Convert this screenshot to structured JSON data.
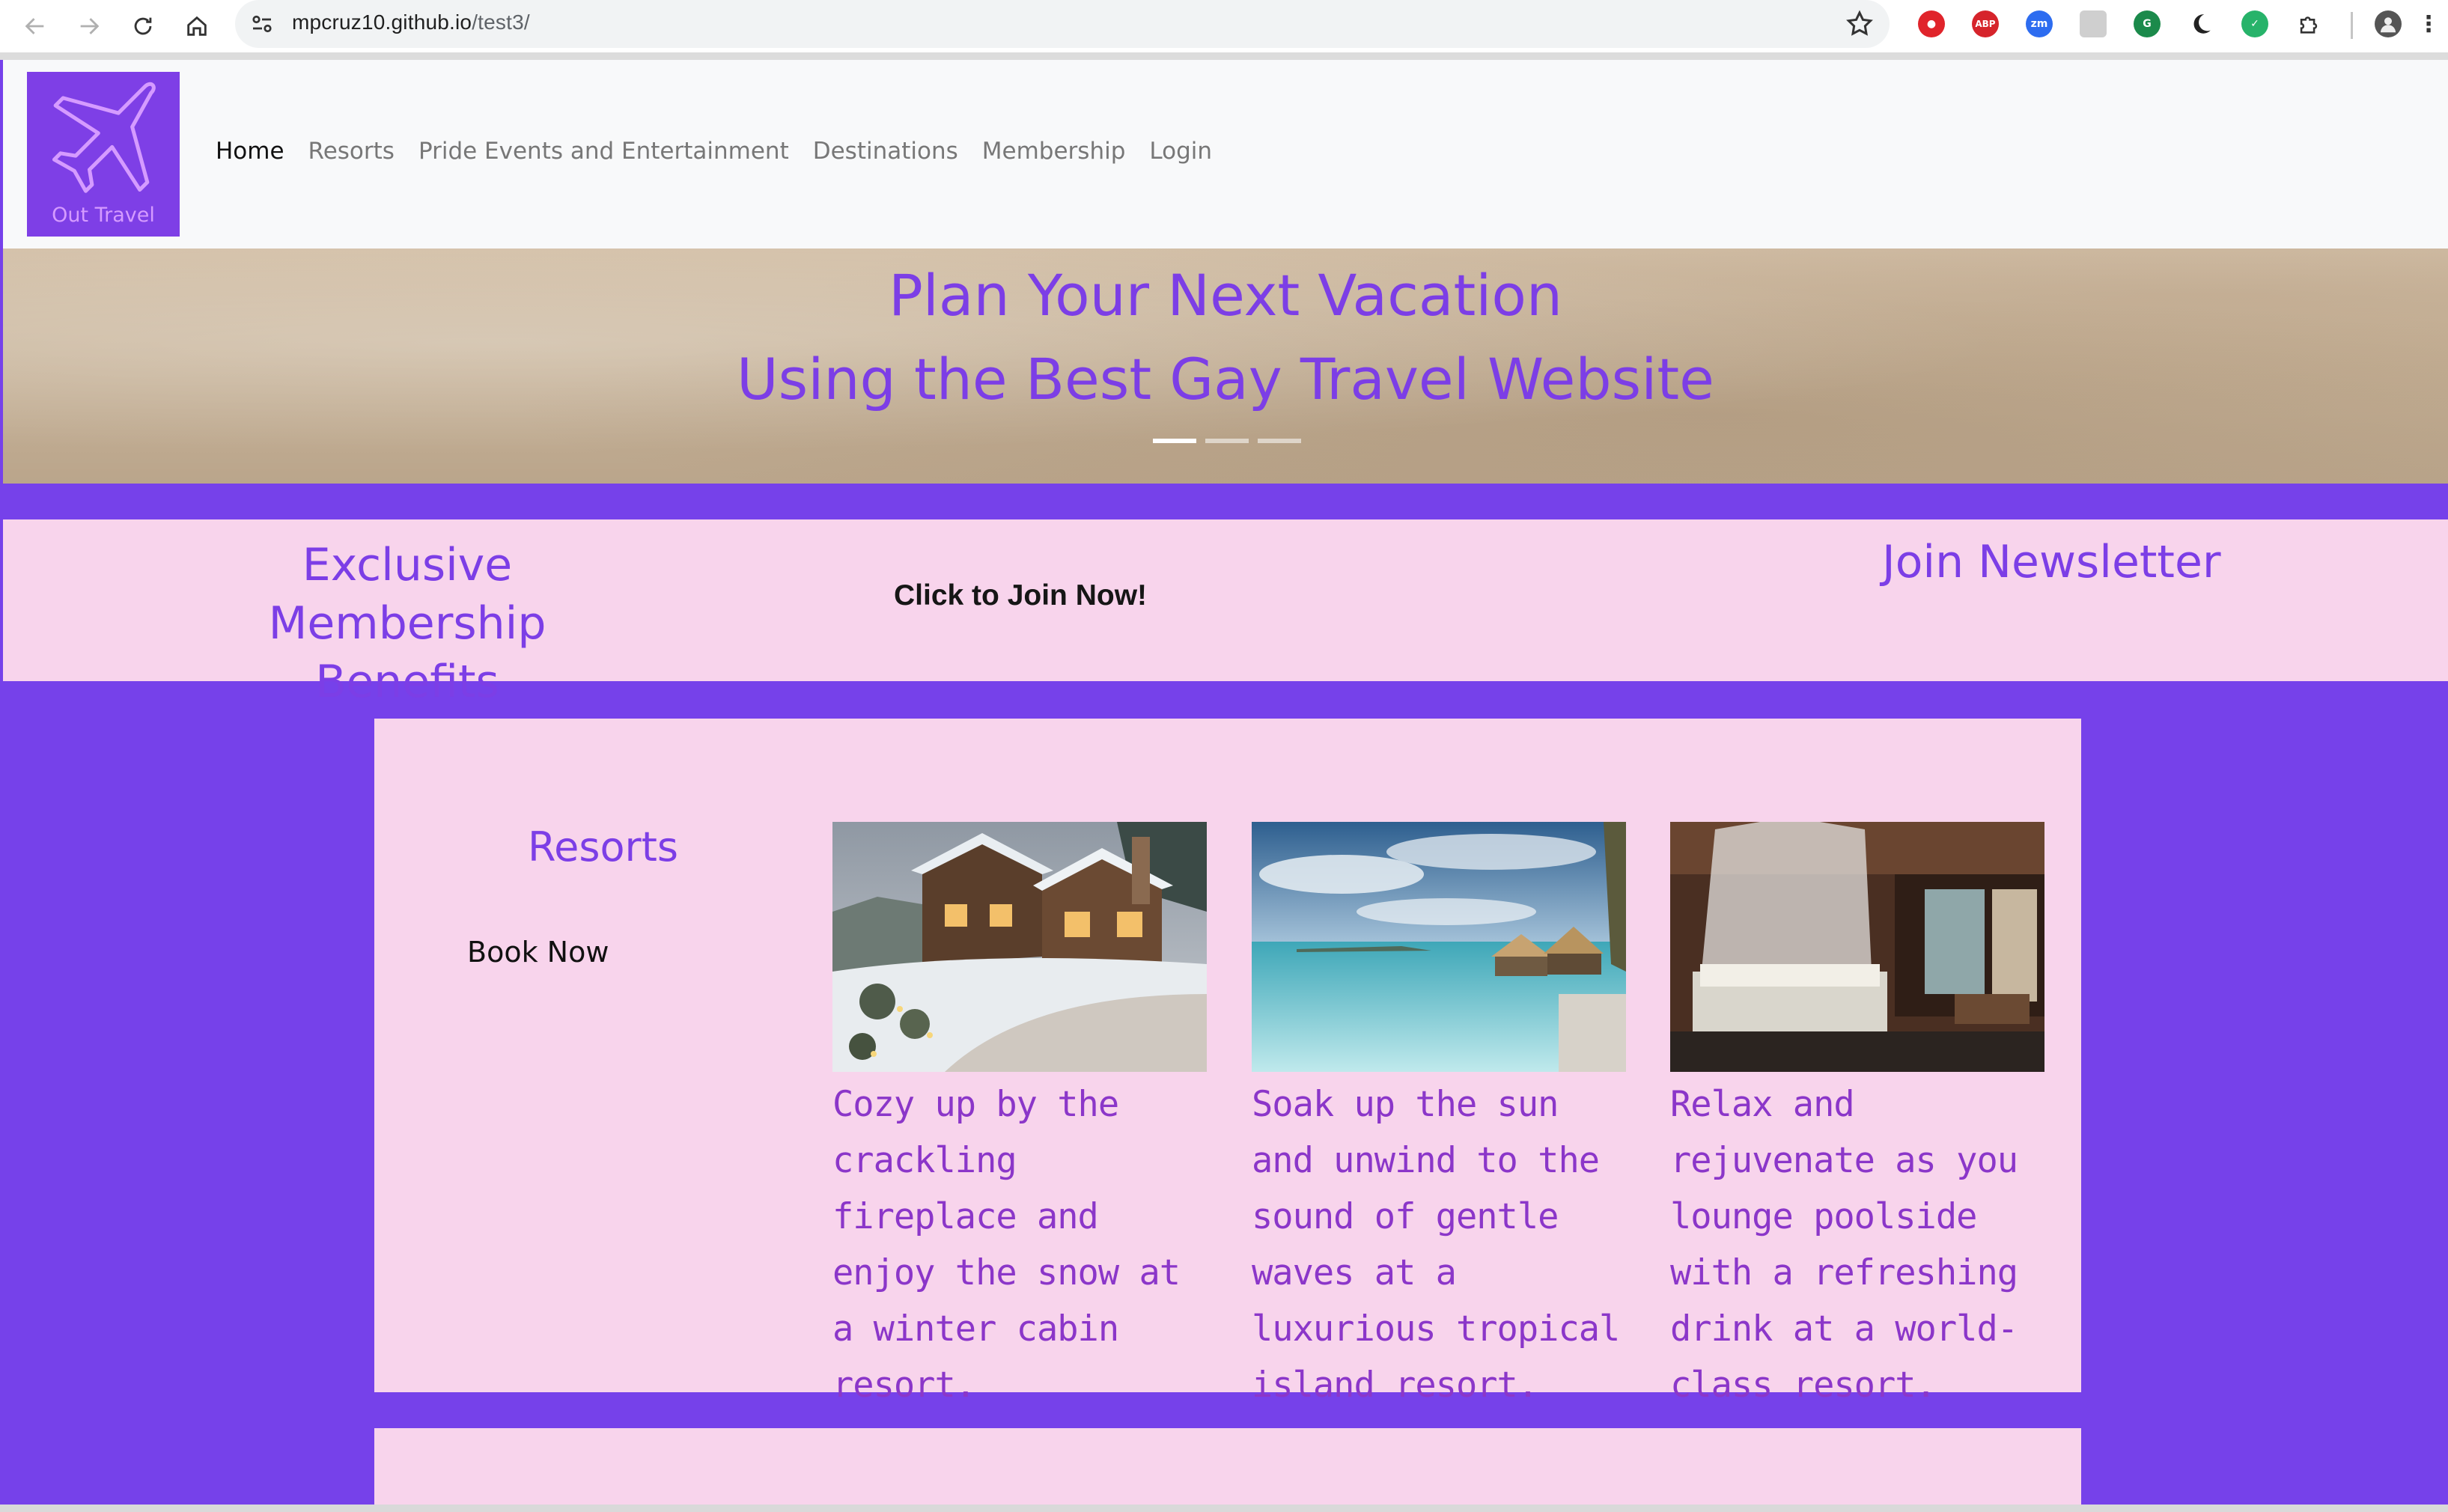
{
  "browser": {
    "url_host": "mpcruz10.github.io",
    "url_path": "/test3/",
    "extension_badges": [
      "ABP",
      "zm"
    ]
  },
  "site": {
    "logo_text": "Out Travel",
    "nav": [
      {
        "label": "Home",
        "active": true
      },
      {
        "label": "Resorts",
        "active": false
      },
      {
        "label": "Pride Events and Entertainment",
        "active": false
      },
      {
        "label": "Destinations",
        "active": false
      },
      {
        "label": "Membership",
        "active": false
      },
      {
        "label": "Login",
        "active": false
      }
    ]
  },
  "hero": {
    "line1": "Plan Your Next Vacation",
    "line2": "Using the Best Gay Travel Website"
  },
  "membership": {
    "benefits_line1": "Exclusive",
    "benefits_line2": "Membership Benefits",
    "join_now": "Click to Join Now!",
    "newsletter": "Join Newsletter"
  },
  "resorts": {
    "title": "Resorts",
    "book_now": "Book Now",
    "cards": [
      {
        "description": "Cozy up by the crackling fireplace and enjoy the snow at a winter cabin resort."
      },
      {
        "description": "Soak up the sun and unwind to the sound of gentle waves at a luxurious tropical island resort."
      },
      {
        "description": "Relax and rejuvenate as you lounge poolside with a refreshing drink at a world-class resort."
      }
    ]
  },
  "colors": {
    "brand_purple": "#7641ea",
    "heading_purple": "#7c3ee6",
    "pink_panel": "#f8d4ec",
    "card_text": "#8b36c9"
  }
}
